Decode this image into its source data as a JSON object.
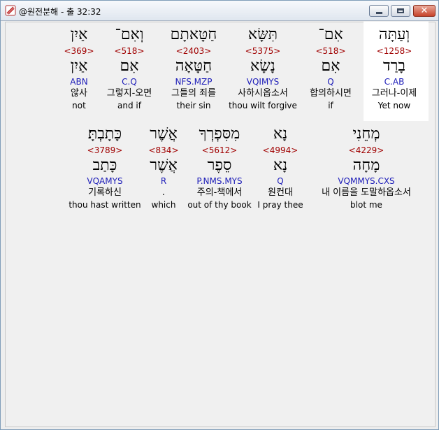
{
  "window": {
    "title": "@원전분해 - 출 32:32",
    "close_label": "✕"
  },
  "verse": {
    "rows": [
      [
        {
          "hebrew": "אַיִן",
          "strong": "<369>",
          "lemma": "אַיִן",
          "morph": "ABN",
          "korean": "않사",
          "english": "not"
        },
        {
          "hebrew": "וְאִם־",
          "strong": "<518>",
          "lemma": "אִם",
          "morph": "C.Q",
          "korean": "그렇지-오면",
          "english": "and if"
        },
        {
          "hebrew": "חַטָּאתָם",
          "strong": "<2403>",
          "lemma": "חַטָּאָה",
          "morph": "NFS.MZP",
          "korean": "그들의 죄를",
          "english": "their sin"
        },
        {
          "hebrew": "תִּשָּׂא",
          "strong": "<5375>",
          "lemma": "נָשָׂא",
          "morph": "VQIMYS",
          "korean": "사하시옵소서",
          "english": "thou wilt forgive"
        },
        {
          "hebrew": "אִם־",
          "strong": "<518>",
          "lemma": "אִם",
          "morph": "Q",
          "korean": "합의하시면",
          "english": "if"
        },
        {
          "hebrew": "וְעַתָּה",
          "strong": "<1258>",
          "lemma": "בָרַד",
          "morph": "C.AB",
          "korean": "그러나-이제",
          "english": "Yet now"
        }
      ],
      [
        {
          "hebrew": "כָּתָבְתָּ׃",
          "strong": "<3789>",
          "lemma": "כָּתַב",
          "morph": "VQAMYS",
          "korean": "기록하신",
          "english": "thou hast written"
        },
        {
          "hebrew": "אֲשֶׁר",
          "strong": "<834>",
          "lemma": "אֲשֶׁר",
          "morph": "R",
          "korean": ".",
          "english": "which"
        },
        {
          "hebrew": "מִסִּפְרְךָ",
          "strong": "<5612>",
          "lemma": "סֵפֶר",
          "morph": "P.NMS.MYS",
          "korean": "주의-책에서",
          "english": "out of thy book"
        },
        {
          "hebrew": "נָא",
          "strong": "<4994>",
          "lemma": "נָא",
          "morph": "Q",
          "korean": "원컨대",
          "english": "I pray thee"
        },
        {
          "hebrew": "מְחֵנִי",
          "strong": "<4229>",
          "lemma": "מָחָה",
          "morph": "VQMMYS.CXS",
          "korean": "내 이름을 도말하옵소서",
          "english": "blot me"
        }
      ]
    ]
  },
  "colors": {
    "strong": "#a00000",
    "morph": "#1c1cb8",
    "highlight": "#ffffff"
  }
}
